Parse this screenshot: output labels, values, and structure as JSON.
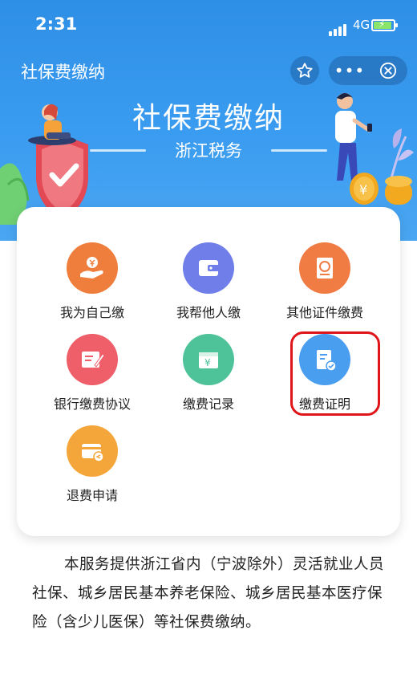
{
  "status_bar": {
    "time": "2:31",
    "network": "4G"
  },
  "header": {
    "title": "社保费缴纳"
  },
  "banner": {
    "title": "社保费缴纳",
    "subtitle": "浙江税务"
  },
  "services": [
    {
      "label": "我为自己缴",
      "icon": "hand-coin-icon",
      "color": "#ef7d3c"
    },
    {
      "label": "我帮他人缴",
      "icon": "wallet-icon",
      "color": "#6f7ee8"
    },
    {
      "label": "其他证件缴费",
      "icon": "passport-icon",
      "color": "#f07c44"
    },
    {
      "label": "银行缴费协议",
      "icon": "agreement-edit-icon",
      "color": "#ee5f6a"
    },
    {
      "label": "缴费记录",
      "icon": "payment-record-icon",
      "color": "#4ec39a"
    },
    {
      "label": "缴费证明",
      "icon": "payment-certificate-icon",
      "color": "#4a9ef0"
    },
    {
      "label": "退费申请",
      "icon": "refund-card-icon",
      "color": "#f4a63a"
    }
  ],
  "description": "本服务提供浙江省内（宁波除外）灵活就业人员社保、城乡居民基本养老保险、城乡居民基本医疗保险（含少儿医保）等社保费缴纳。"
}
